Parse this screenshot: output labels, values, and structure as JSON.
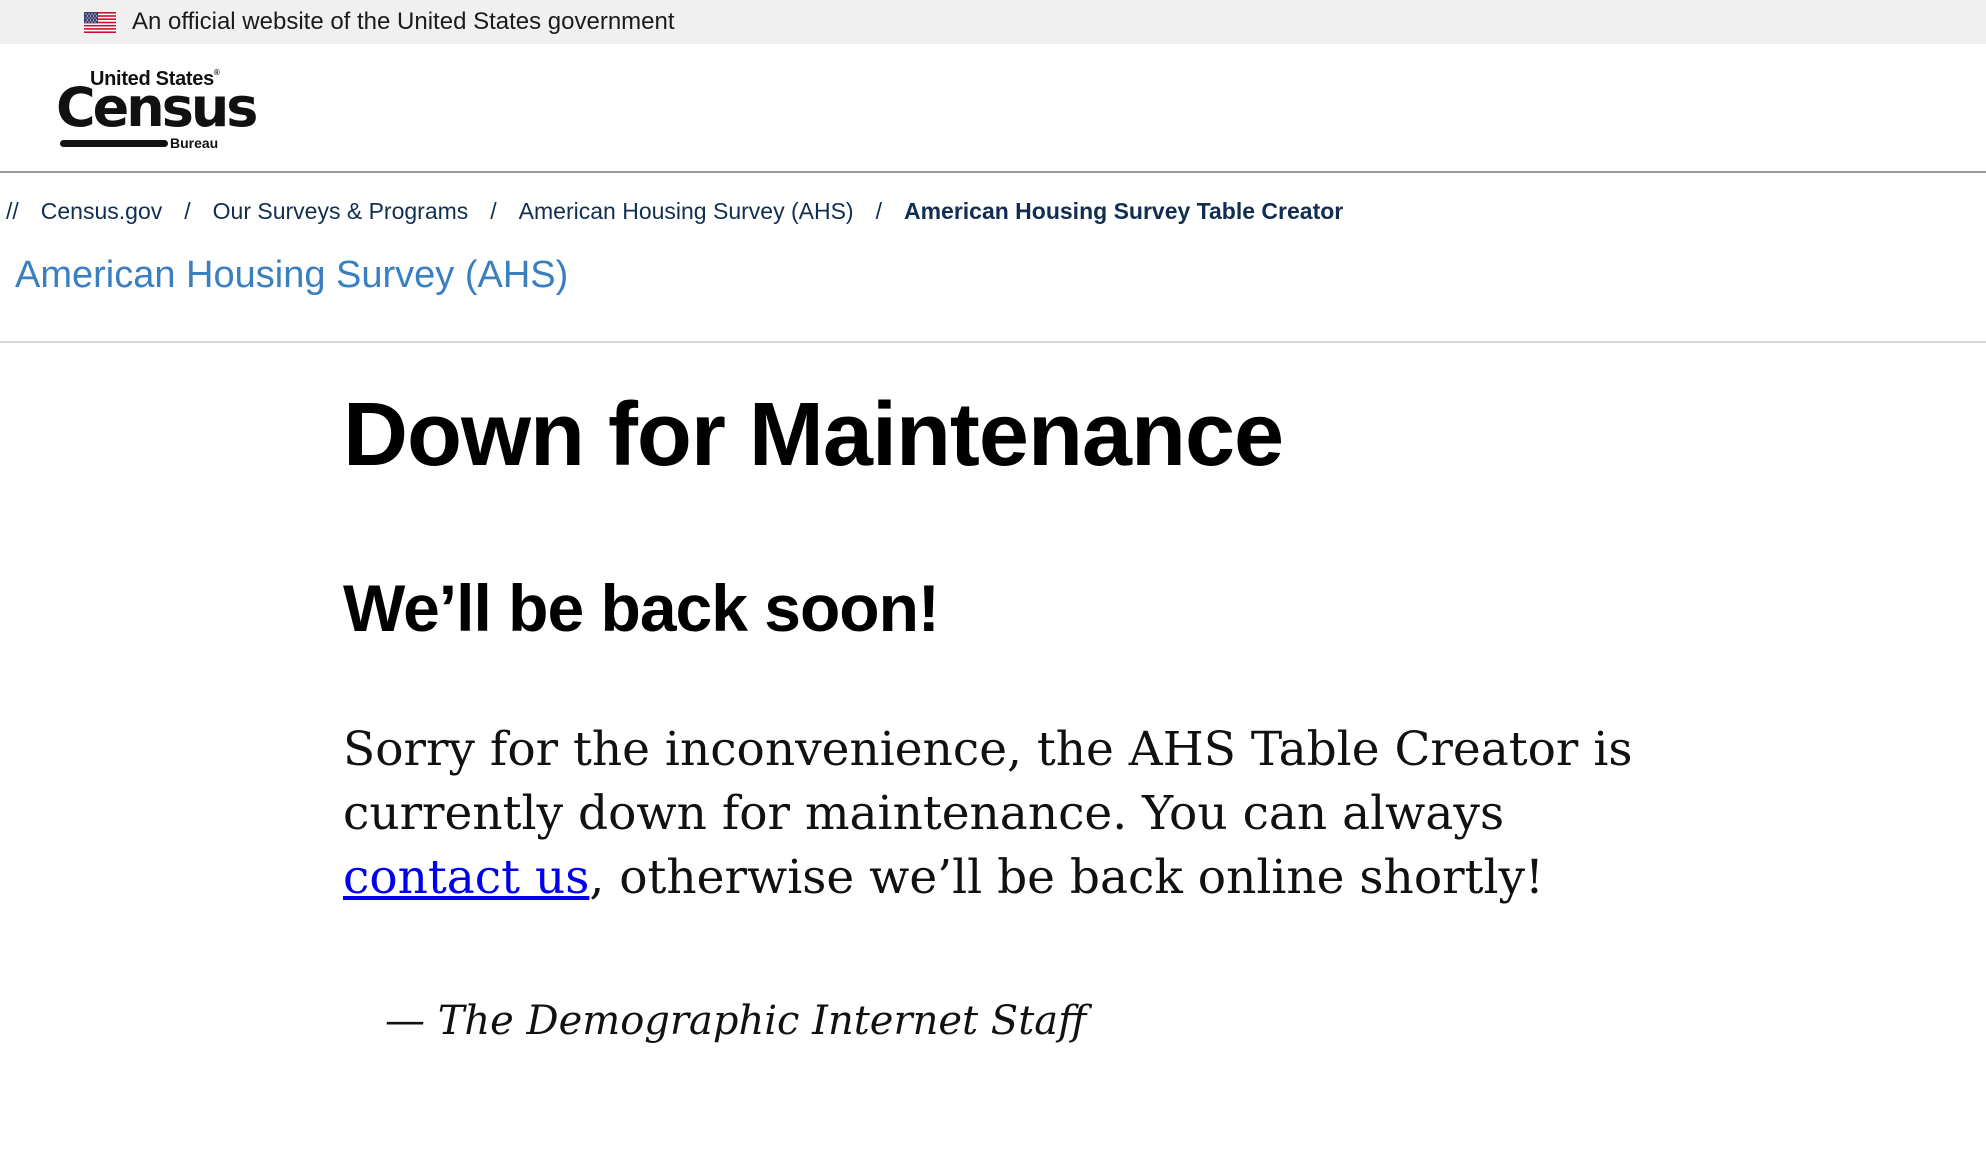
{
  "gov_banner": {
    "text": "An official website of the United States government",
    "flag_icon": "us-flag-icon"
  },
  "header": {
    "logo": {
      "top": "United States",
      "registered": "®",
      "main": "Census",
      "bottom": "Bureau"
    }
  },
  "breadcrumb": {
    "lead": "//",
    "separator": "/",
    "items": [
      {
        "label": "Census.gov"
      },
      {
        "label": "Our Surveys & Programs"
      },
      {
        "label": "American Housing Survey (AHS)"
      },
      {
        "label": "American Housing Survey Table Creator"
      }
    ]
  },
  "section": {
    "title": "American Housing Survey (AHS)"
  },
  "main": {
    "heading": "Down for Maintenance",
    "subheading": "We’ll be back soon!",
    "message_before": "Sorry for the inconvenience, the AHS Table Creator is currently down for maintenance. You can always ",
    "contact_link": "contact us",
    "message_after": ", otherwise we’ll be back online shortly!",
    "signature": "— The Demographic Internet Staff"
  },
  "colors": {
    "gov_banner_bg": "#f0f0f0",
    "breadcrumb_text": "#112e51",
    "section_title": "#3a7fbf",
    "link": "#0000ee"
  }
}
